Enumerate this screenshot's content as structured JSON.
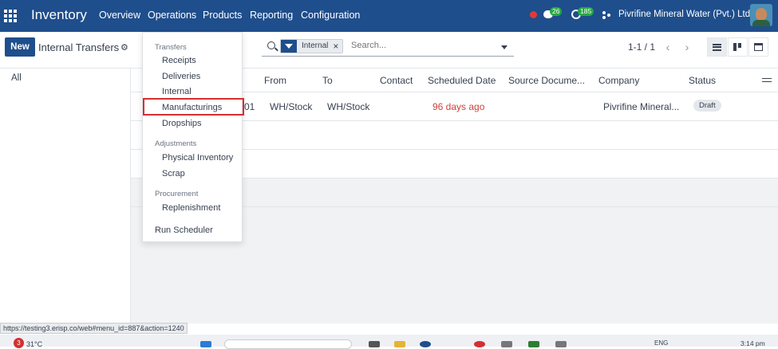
{
  "navbar": {
    "app_title": "Inventory",
    "menu": [
      "Overview",
      "Operations",
      "Products",
      "Reporting",
      "Configuration"
    ],
    "chat_badge": "26",
    "activity_badge": "185",
    "company": "Pivrifine Mineral Water (Pvt.) Ltd."
  },
  "control": {
    "new_label": "New",
    "title": "Internal Transfers",
    "facet_label": "Internal",
    "search_placeholder": "Search...",
    "pager": "1-1 / 1"
  },
  "sidebar": {
    "all_label": "All"
  },
  "table": {
    "columns": [
      "From",
      "To",
      "Contact",
      "Scheduled Date",
      "Source Docume...",
      "Company",
      "Status"
    ],
    "rows": [
      {
        "ref_suffix": "01",
        "from": "WH/Stock",
        "to": "WH/Stock",
        "contact": "",
        "scheduled": "96 days ago",
        "source": "",
        "company": "Pivrifine Mineral...",
        "status": "Draft"
      }
    ]
  },
  "dropdown": {
    "sections": [
      {
        "header": "Transfers",
        "items": [
          "Receipts",
          "Deliveries",
          "Internal",
          "Manufacturings",
          "Dropships"
        ]
      },
      {
        "header": "Adjustments",
        "items": [
          "Physical Inventory",
          "Scrap"
        ]
      },
      {
        "header": "Procurement",
        "items": [
          "Replenishment"
        ]
      }
    ],
    "run_scheduler": "Run Scheduler",
    "highlighted": "Manufacturings"
  },
  "status_url": "https://testing3.erisp.co/web#menu_id=887&action=1240",
  "taskbar": {
    "weather_count": "3",
    "temperature": "31°C",
    "language": "ENG",
    "time": "3:14 pm"
  },
  "colors": {
    "navbar": "#1f4e8c",
    "danger": "#d23f3a",
    "highlight_border": "#d32f2f",
    "badge_green": "#28a745"
  }
}
